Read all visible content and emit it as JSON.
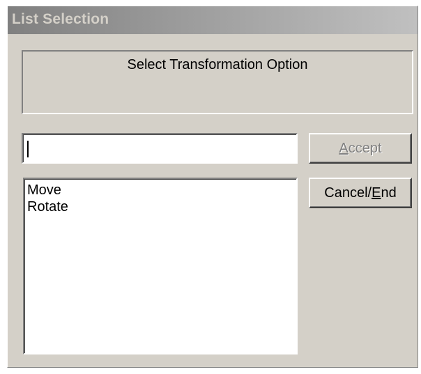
{
  "window": {
    "title": "List Selection"
  },
  "prompt": {
    "text": "Select Transformation Option"
  },
  "entry": {
    "value": ""
  },
  "options": {
    "items": [
      "Move",
      "Rotate"
    ]
  },
  "buttons": {
    "accept": {
      "mnemonic": "A",
      "rest": "ccept",
      "enabled": false
    },
    "cancel": {
      "prefix": "Cancel/",
      "mnemonic": "E",
      "rest": "nd",
      "enabled": true
    }
  },
  "colors": {
    "dialog_bg": "#d4d0c8",
    "titlebar_start": "#808080",
    "titlebar_end": "#c0c0c0",
    "disabled_text": "#808080"
  }
}
